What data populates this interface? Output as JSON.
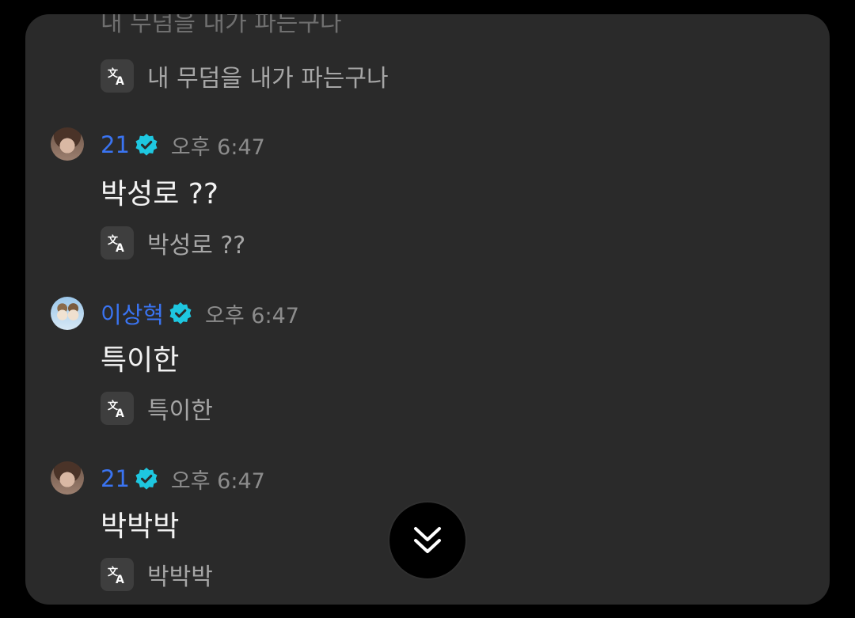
{
  "colors": {
    "background": "#000000",
    "panel": "#2a2a2a",
    "username": "#3a74f2",
    "verified_badge": "#1ec7e0",
    "message_text": "#f2f2f2",
    "translation_text": "#a6a6a6",
    "timestamp": "#8c8c8c"
  },
  "chat": {
    "previous_message_cut": "내 무덤을 내가 파는구나",
    "previous_translation": "내 무덤을 내가 파는구나",
    "messages": [
      {
        "username": "21",
        "verified": true,
        "time": "오후 6:47",
        "text": "박성로 ??",
        "translation": "박성로 ??",
        "avatar_icon": "user-avatar-photo"
      },
      {
        "username": "이상혁",
        "verified": true,
        "time": "오후 6:47",
        "text": "특이한",
        "translation": "특이한",
        "avatar_icon": "user-avatar-photo"
      },
      {
        "username": "21",
        "verified": true,
        "time": "오후 6:47",
        "text": "박박박",
        "translation": "박박박",
        "avatar_icon": "user-avatar-photo"
      }
    ]
  },
  "icons": {
    "translate": "translate-icon",
    "verified": "verified-badge-icon",
    "scroll_down": "double-chevron-down-icon"
  }
}
